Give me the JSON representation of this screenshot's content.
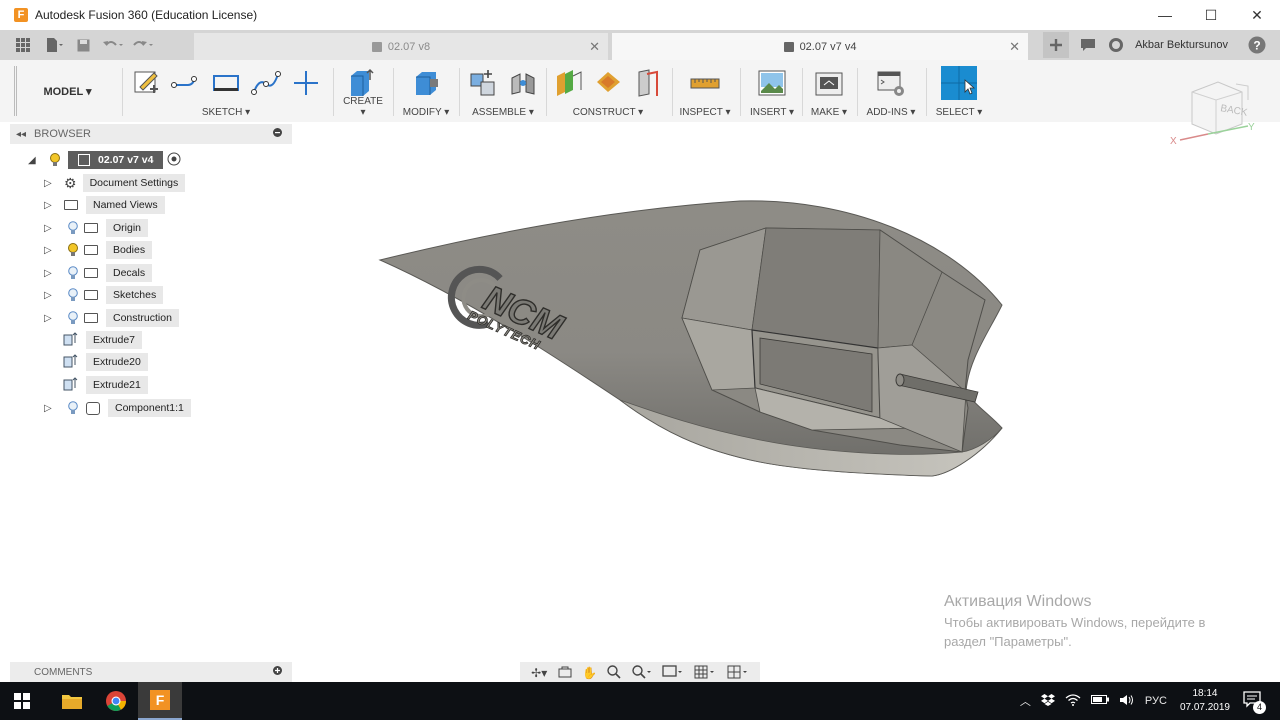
{
  "window": {
    "title": "Autodesk Fusion 360 (Education License)",
    "logo_letter": "F",
    "minimize": "—",
    "maximize": "☐",
    "close": "✕"
  },
  "tabs": [
    {
      "label": "02.07 v8",
      "active": false
    },
    {
      "label": "02.07 v7 v4",
      "active": true
    }
  ],
  "user": {
    "name": "Akbar Bektursunov"
  },
  "toolbar": {
    "workspace": "MODEL ▾",
    "groups": [
      {
        "label": "SKETCH ▾"
      },
      {
        "label": "CREATE ▾"
      },
      {
        "label": "MODIFY ▾"
      },
      {
        "label": "ASSEMBLE ▾"
      },
      {
        "label": "CONSTRUCT ▾"
      },
      {
        "label": "INSPECT ▾"
      },
      {
        "label": "INSERT ▾"
      },
      {
        "label": "MAKE ▾"
      },
      {
        "label": "ADD-INS ▾"
      },
      {
        "label": "SELECT ▾"
      }
    ]
  },
  "browser": {
    "title": "BROWSER",
    "root": "02.07 v7 v4",
    "items": [
      {
        "label": "Document Settings"
      },
      {
        "label": "Named Views"
      },
      {
        "label": "Origin"
      },
      {
        "label": "Bodies"
      },
      {
        "label": "Decals"
      },
      {
        "label": "Sketches"
      },
      {
        "label": "Construction"
      },
      {
        "label": "Extrude7"
      },
      {
        "label": "Extrude20"
      },
      {
        "label": "Extrude21"
      },
      {
        "label": "Component1:1"
      }
    ]
  },
  "viewcube": {
    "face": "BACK",
    "x_axis": "X",
    "y_axis": "Y"
  },
  "model_logo": {
    "main": "NCM",
    "sub": "POLYTECH"
  },
  "comments": {
    "title": "COMMENTS"
  },
  "watermark": {
    "title": "Активация Windows",
    "line1": "Чтобы активировать Windows, перейдите в",
    "line2": "раздел \"Параметры\"."
  },
  "taskbar": {
    "lang": "РУС",
    "time": "18:14",
    "date": "07.07.2019",
    "notifications": "4"
  }
}
